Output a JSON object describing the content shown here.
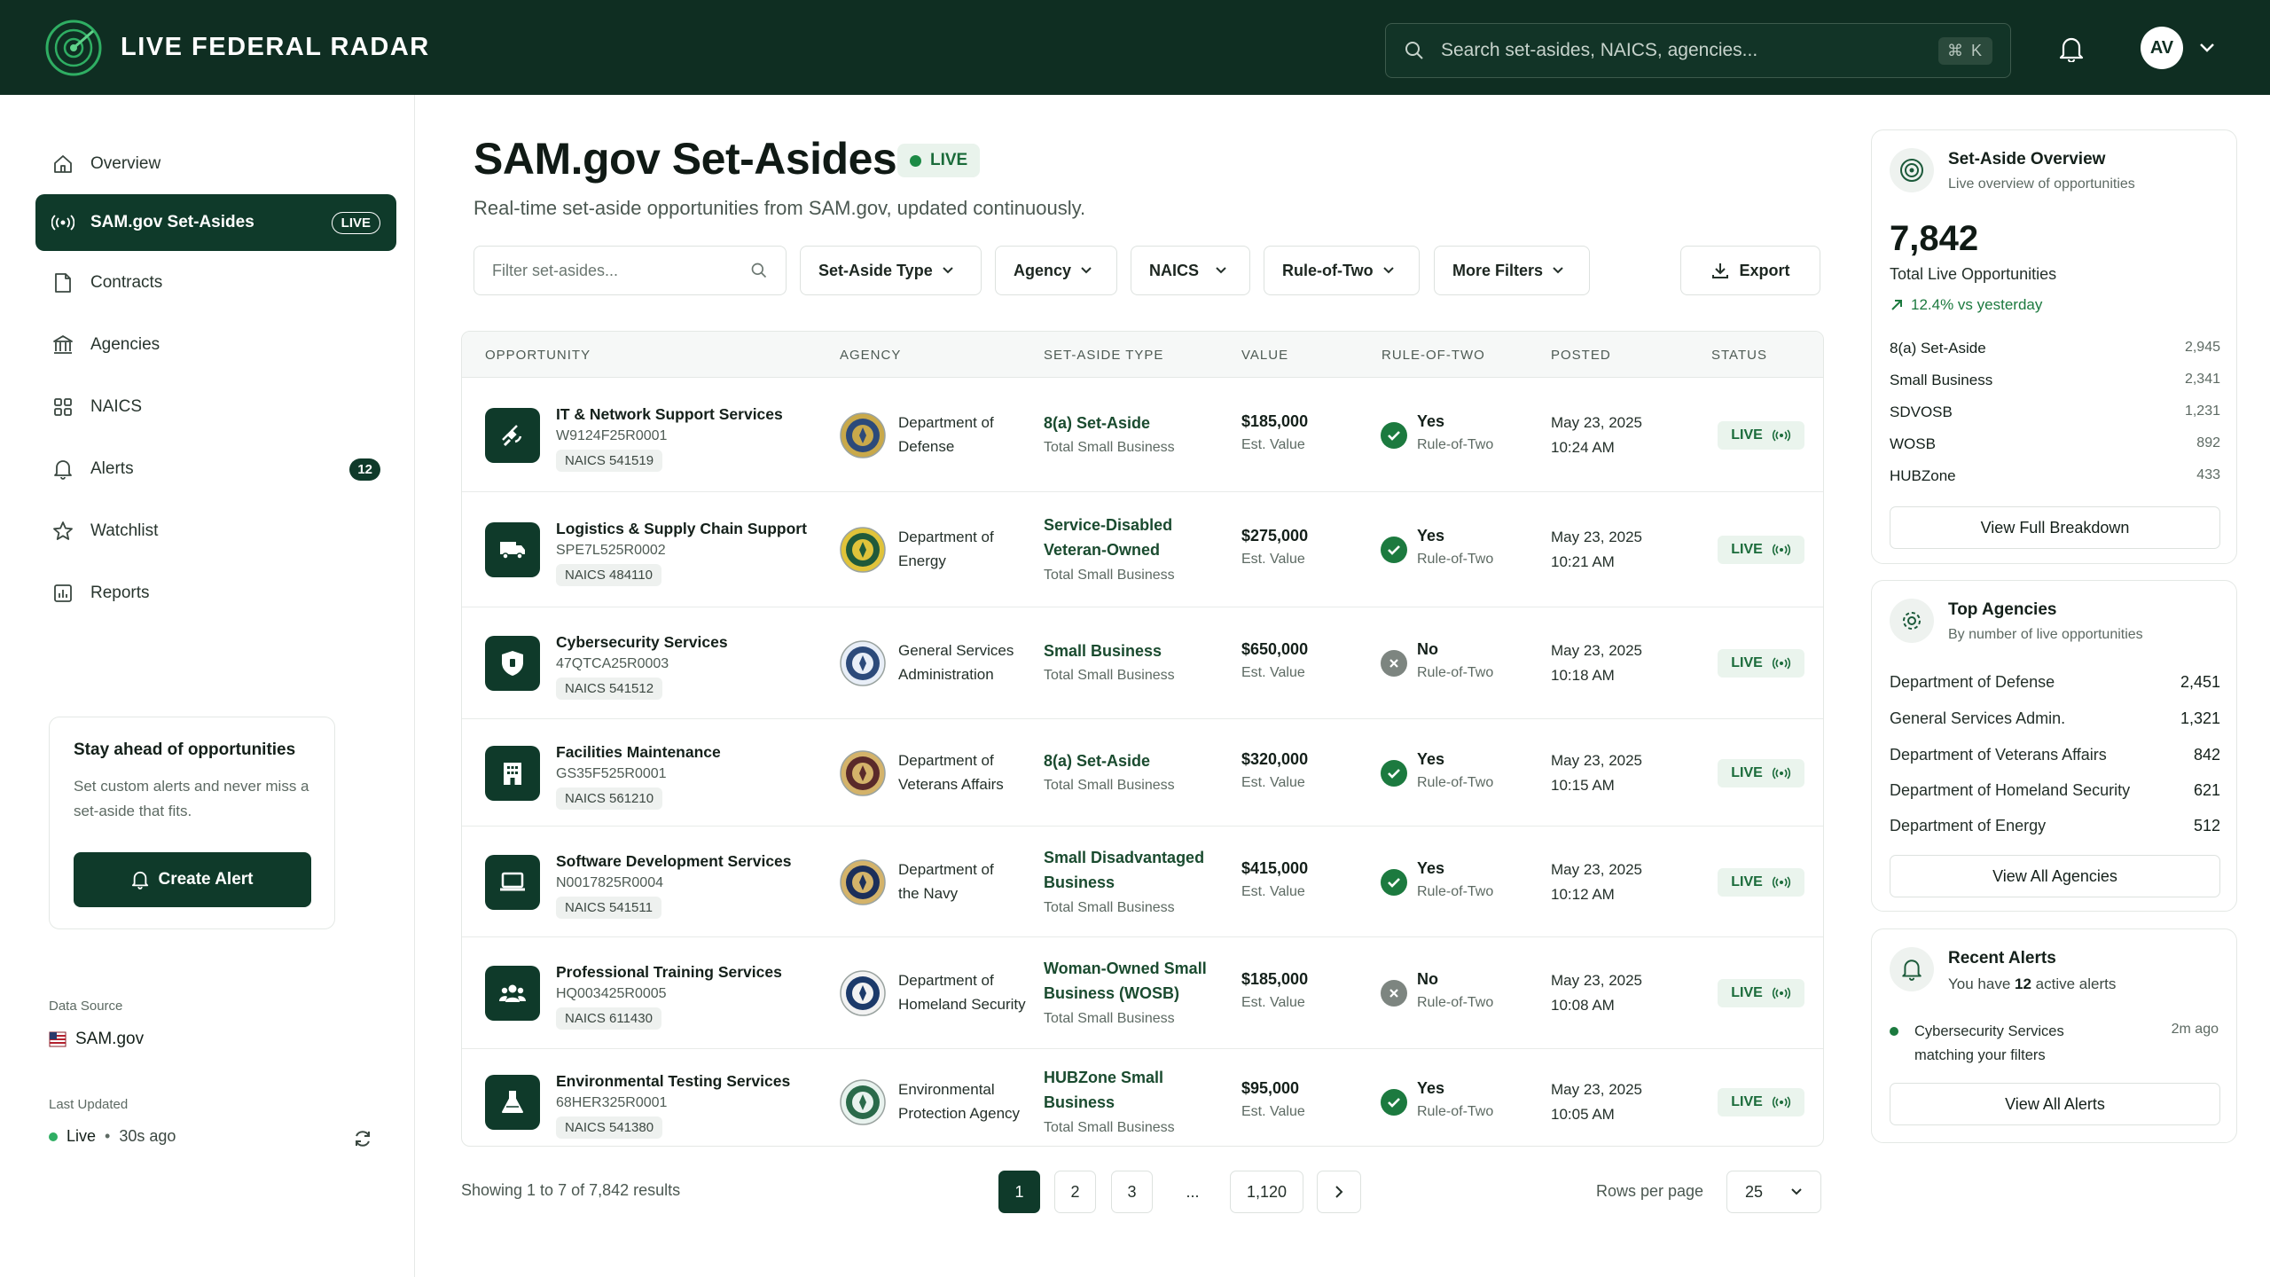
{
  "app": {
    "title": "LIVE FEDERAL RADAR"
  },
  "search": {
    "placeholder": "Search set-asides, NAICS, agencies...",
    "shortcut": "⌘ K"
  },
  "user": {
    "initials": "AV"
  },
  "sidebar": {
    "items": [
      {
        "label": "Overview",
        "icon": "home-icon"
      },
      {
        "label": "SAM.gov Set-Asides",
        "icon": "broadcast-icon",
        "badge": "LIVE"
      },
      {
        "label": "Contracts",
        "icon": "document-icon"
      },
      {
        "label": "Agencies",
        "icon": "building-columns-icon"
      },
      {
        "label": "NAICS",
        "icon": "grid-icon"
      },
      {
        "label": "Alerts",
        "icon": "bell-icon",
        "count": "12"
      },
      {
        "label": "Watchlist",
        "icon": "star-icon"
      },
      {
        "label": "Reports",
        "icon": "bar-chart-icon"
      }
    ],
    "promo": {
      "title": "Stay ahead of opportunities",
      "text": "Set custom alerts and never miss a set-aside that fits.",
      "button": "Create Alert"
    },
    "data_source_label": "Data Source",
    "data_source": "SAM.gov",
    "last_updated_label": "Last Updated",
    "last_updated_status": "Live",
    "last_updated_ago": "30s ago"
  },
  "page": {
    "title": "SAM.gov Set-Asides",
    "live_badge": "LIVE",
    "subtitle": "Real-time set-aside opportunities from SAM.gov, updated continuously."
  },
  "filters": {
    "placeholder": "Filter set-asides...",
    "dropdowns": [
      "Set-Aside Type",
      "Agency",
      "NAICS",
      "Rule-of-Two",
      "More Filters"
    ],
    "export": "Export"
  },
  "table": {
    "columns": [
      "OPPORTUNITY",
      "AGENCY",
      "SET-ASIDE TYPE",
      "VALUE",
      "RULE-OF-TWO",
      "POSTED",
      "STATUS"
    ],
    "rows": [
      {
        "title": "IT & Network Support Services",
        "id": "W9124F25R0001",
        "naics": "NAICS 541519",
        "icon": "satellite-icon",
        "agency1": "Department of",
        "agency2": "Defense",
        "seal": "dod-seal-icon",
        "sat1": "8(a) Set-Aside",
        "sat2": "",
        "sat_sub": "Total Small Business",
        "value": "$185,000",
        "value_sub": "Est. Value",
        "r2": "Yes",
        "r2_sub": "Rule-of-Two",
        "date": "May 23, 2025",
        "time": "10:24 AM",
        "status": "LIVE"
      },
      {
        "title": "Logistics & Supply Chain Support",
        "id": "SPE7L525R0002",
        "naics": "NAICS 484110",
        "icon": "truck-icon",
        "agency1": "Department of",
        "agency2": "Energy",
        "seal": "doe-seal-icon",
        "sat1": "Service-Disabled",
        "sat2": "Veteran-Owned",
        "sat_sub": "Total Small Business",
        "value": "$275,000",
        "value_sub": "Est. Value",
        "r2": "Yes",
        "r2_sub": "Rule-of-Two",
        "date": "May 23, 2025",
        "time": "10:21 AM",
        "status": "LIVE"
      },
      {
        "title": "Cybersecurity Services",
        "id": "47QTCA25R0003",
        "naics": "NAICS 541512",
        "icon": "shield-icon",
        "agency1": "General Services",
        "agency2": "Administration",
        "seal": "gsa-seal-icon",
        "sat1": "Small Business",
        "sat2": "",
        "sat_sub": "Total Small Business",
        "value": "$650,000",
        "value_sub": "Est. Value",
        "r2": "No",
        "r2_sub": "Rule-of-Two",
        "date": "May 23, 2025",
        "time": "10:18 AM",
        "status": "LIVE"
      },
      {
        "title": "Facilities Maintenance",
        "id": "GS35F525R0001",
        "naics": "NAICS 561210",
        "icon": "building-icon",
        "agency1": "Department of",
        "agency2": "Veterans Affairs",
        "seal": "va-seal-icon",
        "sat1": "8(a) Set-Aside",
        "sat2": "",
        "sat_sub": "Total Small Business",
        "value": "$320,000",
        "value_sub": "Est. Value",
        "r2": "Yes",
        "r2_sub": "Rule-of-Two",
        "date": "May 23, 2025",
        "time": "10:15 AM",
        "status": "LIVE"
      },
      {
        "title": "Software Development Services",
        "id": "N0017825R0004",
        "naics": "NAICS 541511",
        "icon": "laptop-icon",
        "agency1": "Department of",
        "agency2": "the Navy",
        "seal": "navy-seal-icon",
        "sat1": "Small Disadvantaged",
        "sat2": "Business",
        "sat_sub": "Total Small Business",
        "value": "$415,000",
        "value_sub": "Est. Value",
        "r2": "Yes",
        "r2_sub": "Rule-of-Two",
        "date": "May 23, 2025",
        "time": "10:12 AM",
        "status": "LIVE"
      },
      {
        "title": "Professional Training Services",
        "id": "HQ003425R0005",
        "naics": "NAICS 611430",
        "icon": "people-icon",
        "agency1": "Department of",
        "agency2": "Homeland Security",
        "seal": "dhs-seal-icon",
        "sat1": "Woman-Owned Small",
        "sat2": "Business (WOSB)",
        "sat_sub": "Total Small Business",
        "value": "$185,000",
        "value_sub": "Est. Value",
        "r2": "No",
        "r2_sub": "Rule-of-Two",
        "date": "May 23, 2025",
        "time": "10:08 AM",
        "status": "LIVE"
      },
      {
        "title": "Environmental Testing Services",
        "id": "68HER325R0001",
        "naics": "NAICS 541380",
        "icon": "flask-icon",
        "agency1": "Environmental",
        "agency2": "Protection Agency",
        "seal": "epa-seal-icon",
        "sat1": "HUBZone Small",
        "sat2": "Business",
        "sat_sub": "Total Small Business",
        "value": "$95,000",
        "value_sub": "Est. Value",
        "r2": "Yes",
        "r2_sub": "Rule-of-Two",
        "date": "May 23, 2025",
        "time": "10:05 AM",
        "status": "LIVE"
      }
    ]
  },
  "pagination": {
    "summary": "Showing 1 to 7 of 7,842 results",
    "pages": [
      "1",
      "2",
      "3",
      "...",
      "1,120"
    ],
    "rows_per_page_label": "Rows per page",
    "rows_per_page": "25"
  },
  "overview": {
    "title": "Set-Aside Overview",
    "subtitle": "Live overview of opportunities",
    "total": "7,842",
    "total_label": "Total Live Opportunities",
    "change": "12.4% vs yesterday",
    "breakdown": [
      {
        "label": "8(a) Set-Aside",
        "value": "2,945"
      },
      {
        "label": "Small Business",
        "value": "2,341"
      },
      {
        "label": "SDVOSB",
        "value": "1,231"
      },
      {
        "label": "WOSB",
        "value": "892"
      },
      {
        "label": "HUBZone",
        "value": "433"
      }
    ],
    "button": "View Full Breakdown"
  },
  "top_agencies": {
    "title": "Top Agencies",
    "subtitle": "By number of live opportunities",
    "items": [
      {
        "label": "Department of Defense",
        "value": "2,451"
      },
      {
        "label": "General Services Admin.",
        "value": "1,321"
      },
      {
        "label": "Department of Veterans Affairs",
        "value": "842"
      },
      {
        "label": "Department of Homeland Security",
        "value": "621"
      },
      {
        "label": "Department of Energy",
        "value": "512"
      }
    ],
    "button": "View All Agencies"
  },
  "recent_alerts": {
    "title": "Recent Alerts",
    "subtitle_pre": "You have ",
    "subtitle_count": "12",
    "subtitle_post": " active alerts",
    "alert_text1": "Cybersecurity Services",
    "alert_text2": "matching your filters",
    "alert_time": "2m ago",
    "button": "View All Alerts"
  },
  "colors": {
    "brand": "#0f2e22",
    "accent": "#0f3a2a",
    "live_green": "#1c8a45"
  }
}
